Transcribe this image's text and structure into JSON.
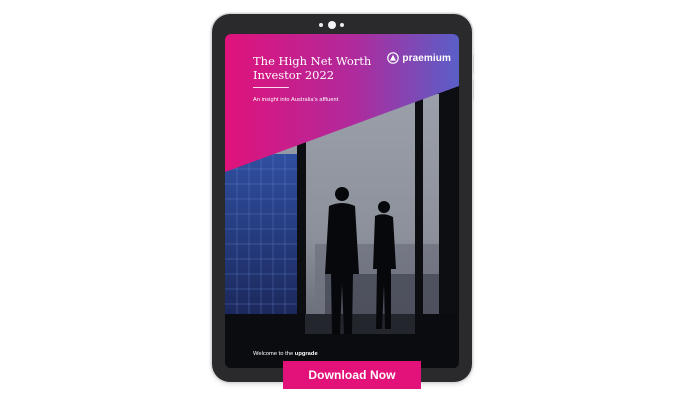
{
  "cover": {
    "title": "The High Net Worth Investor 2022",
    "subtitle": "An insight into Australia's affluent",
    "welcome_prefix": "Welcome to the",
    "welcome_bold": "upgrade",
    "brand_name": "praemium"
  },
  "cta": {
    "download_label": "Download Now"
  },
  "colors": {
    "accent": "#e2127a",
    "gradient_start": "#e0127b",
    "gradient_end": "#5a5fc8",
    "frame": "#2a2a2c"
  },
  "icons": {
    "brand": "praemium-logo-icon"
  }
}
